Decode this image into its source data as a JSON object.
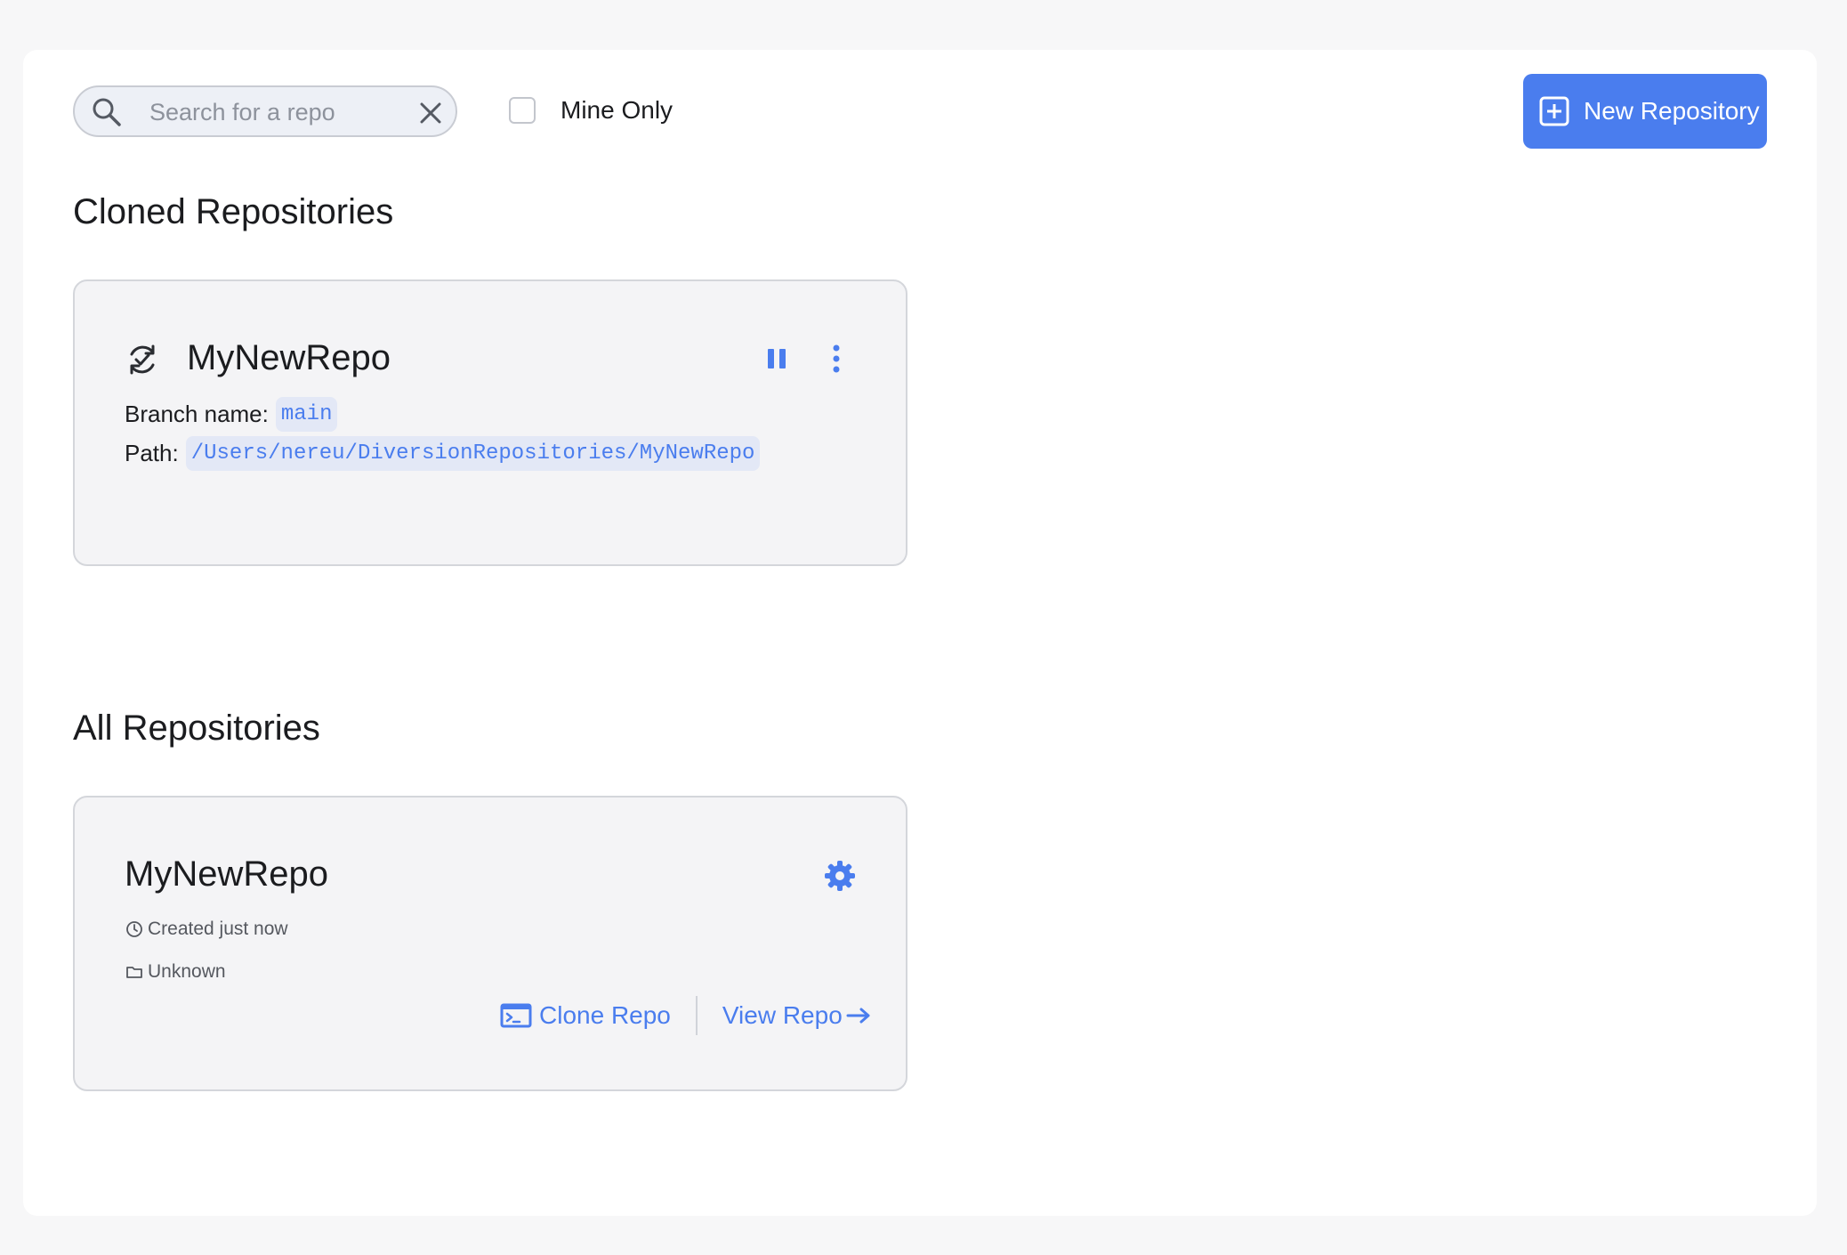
{
  "toolbar": {
    "search_placeholder": "Search for a repo",
    "search_value": "",
    "mine_only_label": "Mine Only",
    "mine_only_checked": false,
    "new_repo_label": "New Repository"
  },
  "cloned": {
    "section_title": "Cloned Repositories",
    "repos": [
      {
        "name": "MyNewRepo",
        "branch_label": "Branch name:",
        "branch": "main",
        "path_label": "Path:",
        "path": "/Users/nereu/DiversionRepositories/MyNewRepo"
      }
    ]
  },
  "all": {
    "section_title": "All Repositories",
    "repos": [
      {
        "name": "MyNewRepo",
        "created": "Created just now",
        "location": "Unknown",
        "clone_label": "Clone Repo",
        "view_label": "View Repo"
      }
    ]
  },
  "colors": {
    "accent": "#4a7dee",
    "card_bg": "#f4f4f6",
    "page_bg": "#f7f7f8"
  },
  "icons": [
    "search-icon",
    "close-icon",
    "plus-square-icon",
    "sync-check-icon",
    "pause-icon",
    "more-vertical-icon",
    "gear-icon",
    "clock-icon",
    "folder-icon",
    "terminal-icon",
    "arrow-right-icon"
  ]
}
